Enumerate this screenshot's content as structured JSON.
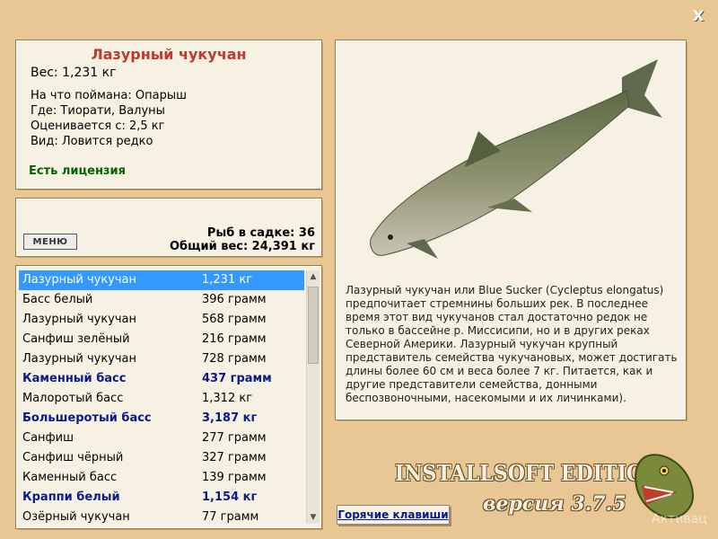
{
  "close_label": "X",
  "info": {
    "title": "Лазурный чукучан",
    "weight": "Вес: 1,231 кг",
    "bait": "На что поймана: Опарыш",
    "place": "Где: Тиорати, Валуны",
    "valued": "Оценивается с: 2,5 кг",
    "kind": "Вид: Ловится редко",
    "license": "Есть лицензия"
  },
  "stats": {
    "menu_label": "МЕНЮ",
    "fish_count": "Рыб в садке: 36",
    "total_weight": "Общий вес: 24,391 кг"
  },
  "catch_list": [
    {
      "name": "Лазурный чукучан",
      "weight": "1,231 кг",
      "selected": true,
      "highlight": false
    },
    {
      "name": "Басс белый",
      "weight": "396 грамм",
      "selected": false,
      "highlight": false
    },
    {
      "name": "Лазурный чукучан",
      "weight": "568 грамм",
      "selected": false,
      "highlight": false
    },
    {
      "name": "Санфиш зелёный",
      "weight": "216 грамм",
      "selected": false,
      "highlight": false
    },
    {
      "name": "Лазурный чукучан",
      "weight": "728 грамм",
      "selected": false,
      "highlight": false
    },
    {
      "name": "Каменный басс",
      "weight": "437 грамм",
      "selected": false,
      "highlight": true
    },
    {
      "name": "Малоротый басс",
      "weight": "1,312 кг",
      "selected": false,
      "highlight": false
    },
    {
      "name": "Большеротый басс",
      "weight": "3,187 кг",
      "selected": false,
      "highlight": true
    },
    {
      "name": "Санфиш",
      "weight": "277 грамм",
      "selected": false,
      "highlight": false
    },
    {
      "name": "Санфиш чёрный",
      "weight": "327 грамм",
      "selected": false,
      "highlight": false
    },
    {
      "name": "Каменный басс",
      "weight": "139 грамм",
      "selected": false,
      "highlight": false
    },
    {
      "name": "Краппи белый",
      "weight": "1,154 кг",
      "selected": false,
      "highlight": true
    },
    {
      "name": "Озёрный чукучан",
      "weight": "77 грамм",
      "selected": false,
      "highlight": false
    }
  ],
  "detail": {
    "description": "Лазурный чукучан или Blue Sucker (Cycleptus elongatus) предпочитает стремнины больших рек. В последнее время этот вид чукучанов стал достаточно редок не только в бассейне р. Миссисипи, но и в других реках Северной Америки. Лазурный чукучан крупный представитель семейства чукучановых, может достигать длины более 60 см и веса более 7 кг. Питается, как и другие представители семейства, донными беспозвоночными, насекомыми и их личинками)."
  },
  "hotkeys_label": "Горячие клавиши",
  "edition_label": "INSTALLSOFT EDITION",
  "version_label": "версия 3.7.5",
  "watermark": "Активац",
  "colors": {
    "background": "#e8c795",
    "panel": "#f6f1e2",
    "selection": "#3399ff",
    "highlight_text": "#0a1a8a",
    "title_text": "#c0392b",
    "license_text": "#006400"
  }
}
